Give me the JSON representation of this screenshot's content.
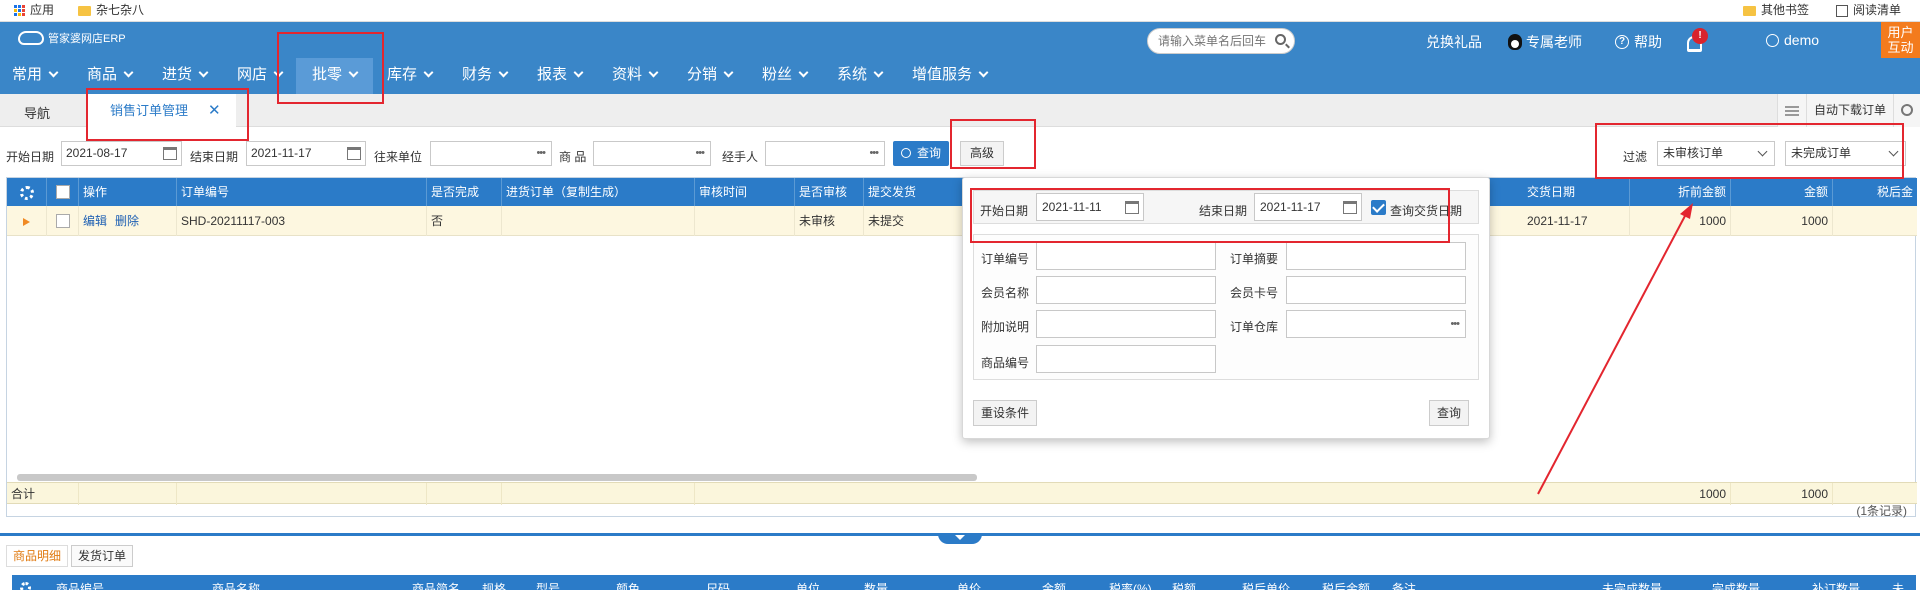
{
  "bookmarks": {
    "apps": "应用",
    "folder1": "杂七杂八",
    "folder2": "其他书签",
    "reading_list": "阅读清单"
  },
  "app": {
    "logo": "管家婆网店ERP"
  },
  "search": {
    "placeholder": "请输入菜单名后回车"
  },
  "top_links": {
    "gift": "兑换礼品",
    "teacher": "专属老师",
    "help": "帮助",
    "notify_badge": "!",
    "user": "demo",
    "interact": [
      "用户",
      "互动"
    ]
  },
  "menu": [
    "常用",
    "商品",
    "进货",
    "网店",
    "批零",
    "库存",
    "财务",
    "报表",
    "资料",
    "分销",
    "粉丝",
    "系统",
    "增值服务"
  ],
  "menu_active_index": 4,
  "tabs": {
    "nav": "导航",
    "active": "销售订单管理",
    "close": "✕",
    "auto_download": "自动下载订单"
  },
  "filter": {
    "start_label": "开始日期",
    "start_value": "2021-08-17",
    "end_label": "结束日期",
    "end_value": "2021-11-17",
    "partner_label": "往来单位",
    "goods_label": "商 品",
    "handler_label": "经手人",
    "query_btn": "查询",
    "advanced_btn": "高级",
    "filter_label": "过滤",
    "sel1": "未审核订单",
    "sel2": "未完成订单",
    "dots": "•••"
  },
  "grid": {
    "headers": [
      "操作",
      "订单编号",
      "是否完成",
      "进货订单（复制生成）",
      "审核时间",
      "是否审核",
      "提交发货",
      "交货日期",
      "折前金额",
      "金额",
      "税后金"
    ],
    "row": {
      "edit": "编辑",
      "delete": "删除",
      "order_no": "SHD-20211117-003",
      "done": "否",
      "audited": "未审核",
      "ship": "未提交",
      "delivery": "2021-11-17",
      "pre_amount": "1000",
      "amount": "1000"
    },
    "footer": {
      "label": "合计",
      "pre_amount": "1000",
      "amount": "1000"
    },
    "count": "(1条记录)"
  },
  "bottom": {
    "tabs": [
      "商品明细",
      "发货订单"
    ],
    "headers": [
      "商品编号",
      "商品名称",
      "商品简名",
      "规格",
      "型号",
      "颜色",
      "尺码",
      "单位",
      "数量",
      "单价",
      "金额",
      "税率(%)",
      "税额",
      "税后单价",
      "税后金额",
      "备注",
      "未完成数量",
      "完成数量",
      "补订数量",
      "未"
    ]
  },
  "popup": {
    "start_label": "开始日期",
    "start_value": "2021-11-11",
    "end_label": "结束日期",
    "end_value": "2021-11-17",
    "check_label": "查询交货日期",
    "order_no_label": "订单编号",
    "summary_label": "订单摘要",
    "member_name_label": "会员名称",
    "member_card_label": "会员卡号",
    "extra_label": "附加说明",
    "warehouse_label": "订单仓库",
    "goods_no_label": "商品编号",
    "reset_btn": "重设条件",
    "query_btn": "查询"
  }
}
